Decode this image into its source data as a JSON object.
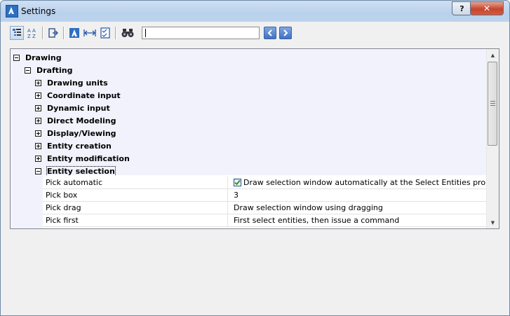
{
  "window": {
    "title": "Settings",
    "help_label": "?",
    "close_label": "✕"
  },
  "toolbar": {
    "search_value": "",
    "buttons": [
      "categorized-view",
      "alphabetical-view",
      "export",
      "drawing-settings",
      "dimension-settings",
      "checklist-settings",
      "find",
      "previous",
      "next"
    ]
  },
  "tree": {
    "nodes": [
      {
        "label": "Drawing",
        "state": "expanded"
      },
      {
        "label": "Drafting",
        "state": "expanded"
      },
      {
        "label": "Drawing units",
        "state": "collapsed"
      },
      {
        "label": "Coordinate input",
        "state": "collapsed"
      },
      {
        "label": "Dynamic input",
        "state": "collapsed"
      },
      {
        "label": "Direct Modeling",
        "state": "collapsed"
      },
      {
        "label": "Display/Viewing",
        "state": "collapsed"
      },
      {
        "label": "Entity creation",
        "state": "collapsed"
      },
      {
        "label": "Entity modification",
        "state": "collapsed"
      },
      {
        "label": "Entity selection",
        "state": "expanded"
      }
    ],
    "properties": [
      {
        "name": "Pick automatic",
        "value": "Draw selection window automatically at the Select Entities prompt",
        "checked": true
      },
      {
        "name": "Pick box",
        "value": "3"
      },
      {
        "name": "Pick drag",
        "value": "Draw selection window using dragging"
      },
      {
        "name": "Pick first",
        "value": "First select entities, then issue a command"
      }
    ]
  },
  "colors": {
    "tree_background": "#f2f2fd",
    "titlebar": "#b9d1ec",
    "close_button": "#c7452d"
  }
}
